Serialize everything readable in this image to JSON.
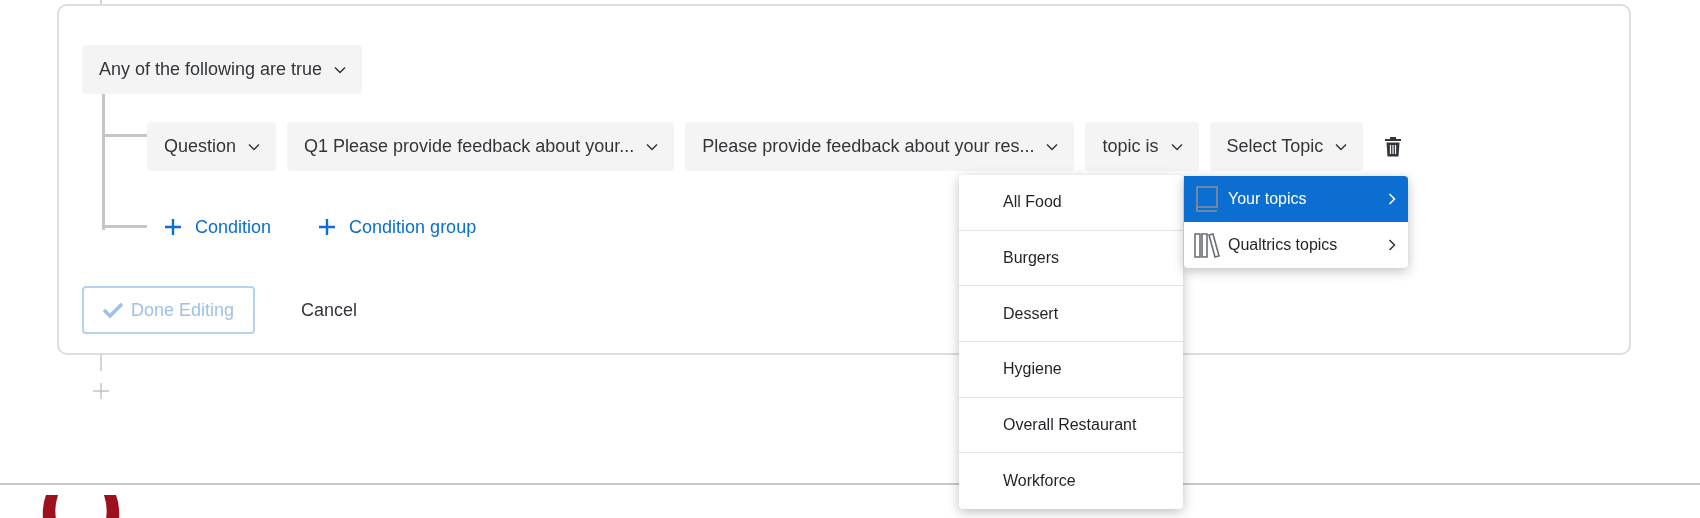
{
  "group": {
    "label": "Any of the following are true"
  },
  "condition": {
    "fields": [
      {
        "label": "Question"
      },
      {
        "label": "Q1 Please provide feedback about your..."
      },
      {
        "label": "Please provide feedback about your res..."
      },
      {
        "label": "topic is"
      },
      {
        "label": "Select Topic"
      }
    ]
  },
  "links": [
    {
      "label": "Condition"
    },
    {
      "label": "Condition group"
    }
  ],
  "actions": {
    "done": {
      "label": "Done Editing",
      "disabled": true
    },
    "cancel": {
      "label": "Cancel"
    }
  },
  "topic_menu": {
    "items": [
      {
        "label": "All Food"
      },
      {
        "label": "Burgers"
      },
      {
        "label": "Dessert"
      },
      {
        "label": "Hygiene"
      },
      {
        "label": "Overall Restaurant"
      },
      {
        "label": "Workforce"
      }
    ]
  },
  "source_menu": {
    "items": [
      {
        "label": "Your topics",
        "selected": true,
        "kind": "own"
      },
      {
        "label": "Qualtrics topics",
        "selected": false,
        "kind": "library"
      }
    ]
  }
}
